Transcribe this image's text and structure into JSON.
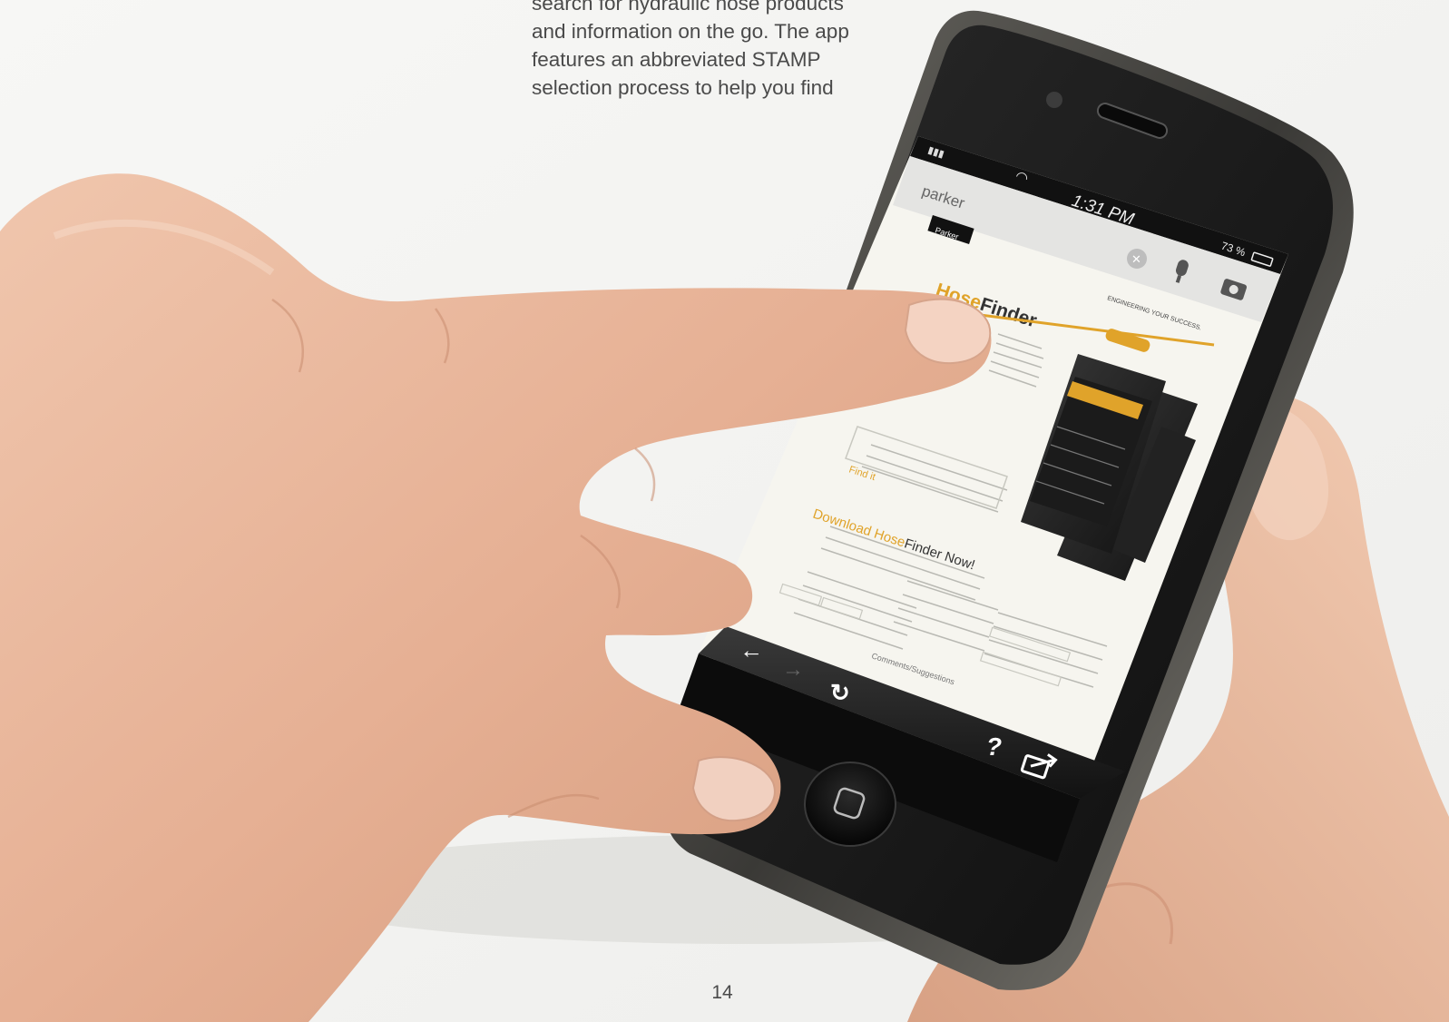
{
  "intro": {
    "lines": [
      "search for hydraulic hose products",
      "and information on the go. The app",
      "features an abbreviated STAMP",
      "selection process to help you find"
    ]
  },
  "phone": {
    "status_bar": {
      "time": "1:31 PM",
      "battery": "73 %"
    },
    "search_query": "parker",
    "web_page": {
      "logo": "Parker",
      "app_name_part1": "Hose",
      "app_name_part2": "Finder",
      "tagline": "ENGINEERING YOUR SUCCESS.",
      "download_heading_part1": "Download Hose",
      "download_heading_part2": "Finder Now!",
      "find_it_heading": "Find it",
      "contact_label": "Comments/Suggestions"
    },
    "toolbar_icons": [
      "back-arrow-icon",
      "forward-arrow-icon",
      "reload-icon",
      "help-icon",
      "share-icon"
    ]
  },
  "page_number": "14",
  "colors": {
    "background": "#f4f4f2",
    "text": "#4a4a4a",
    "brand_orange": "#e0a32a",
    "phone_body": "#1a1a1a",
    "skin": "#e8b89e"
  }
}
